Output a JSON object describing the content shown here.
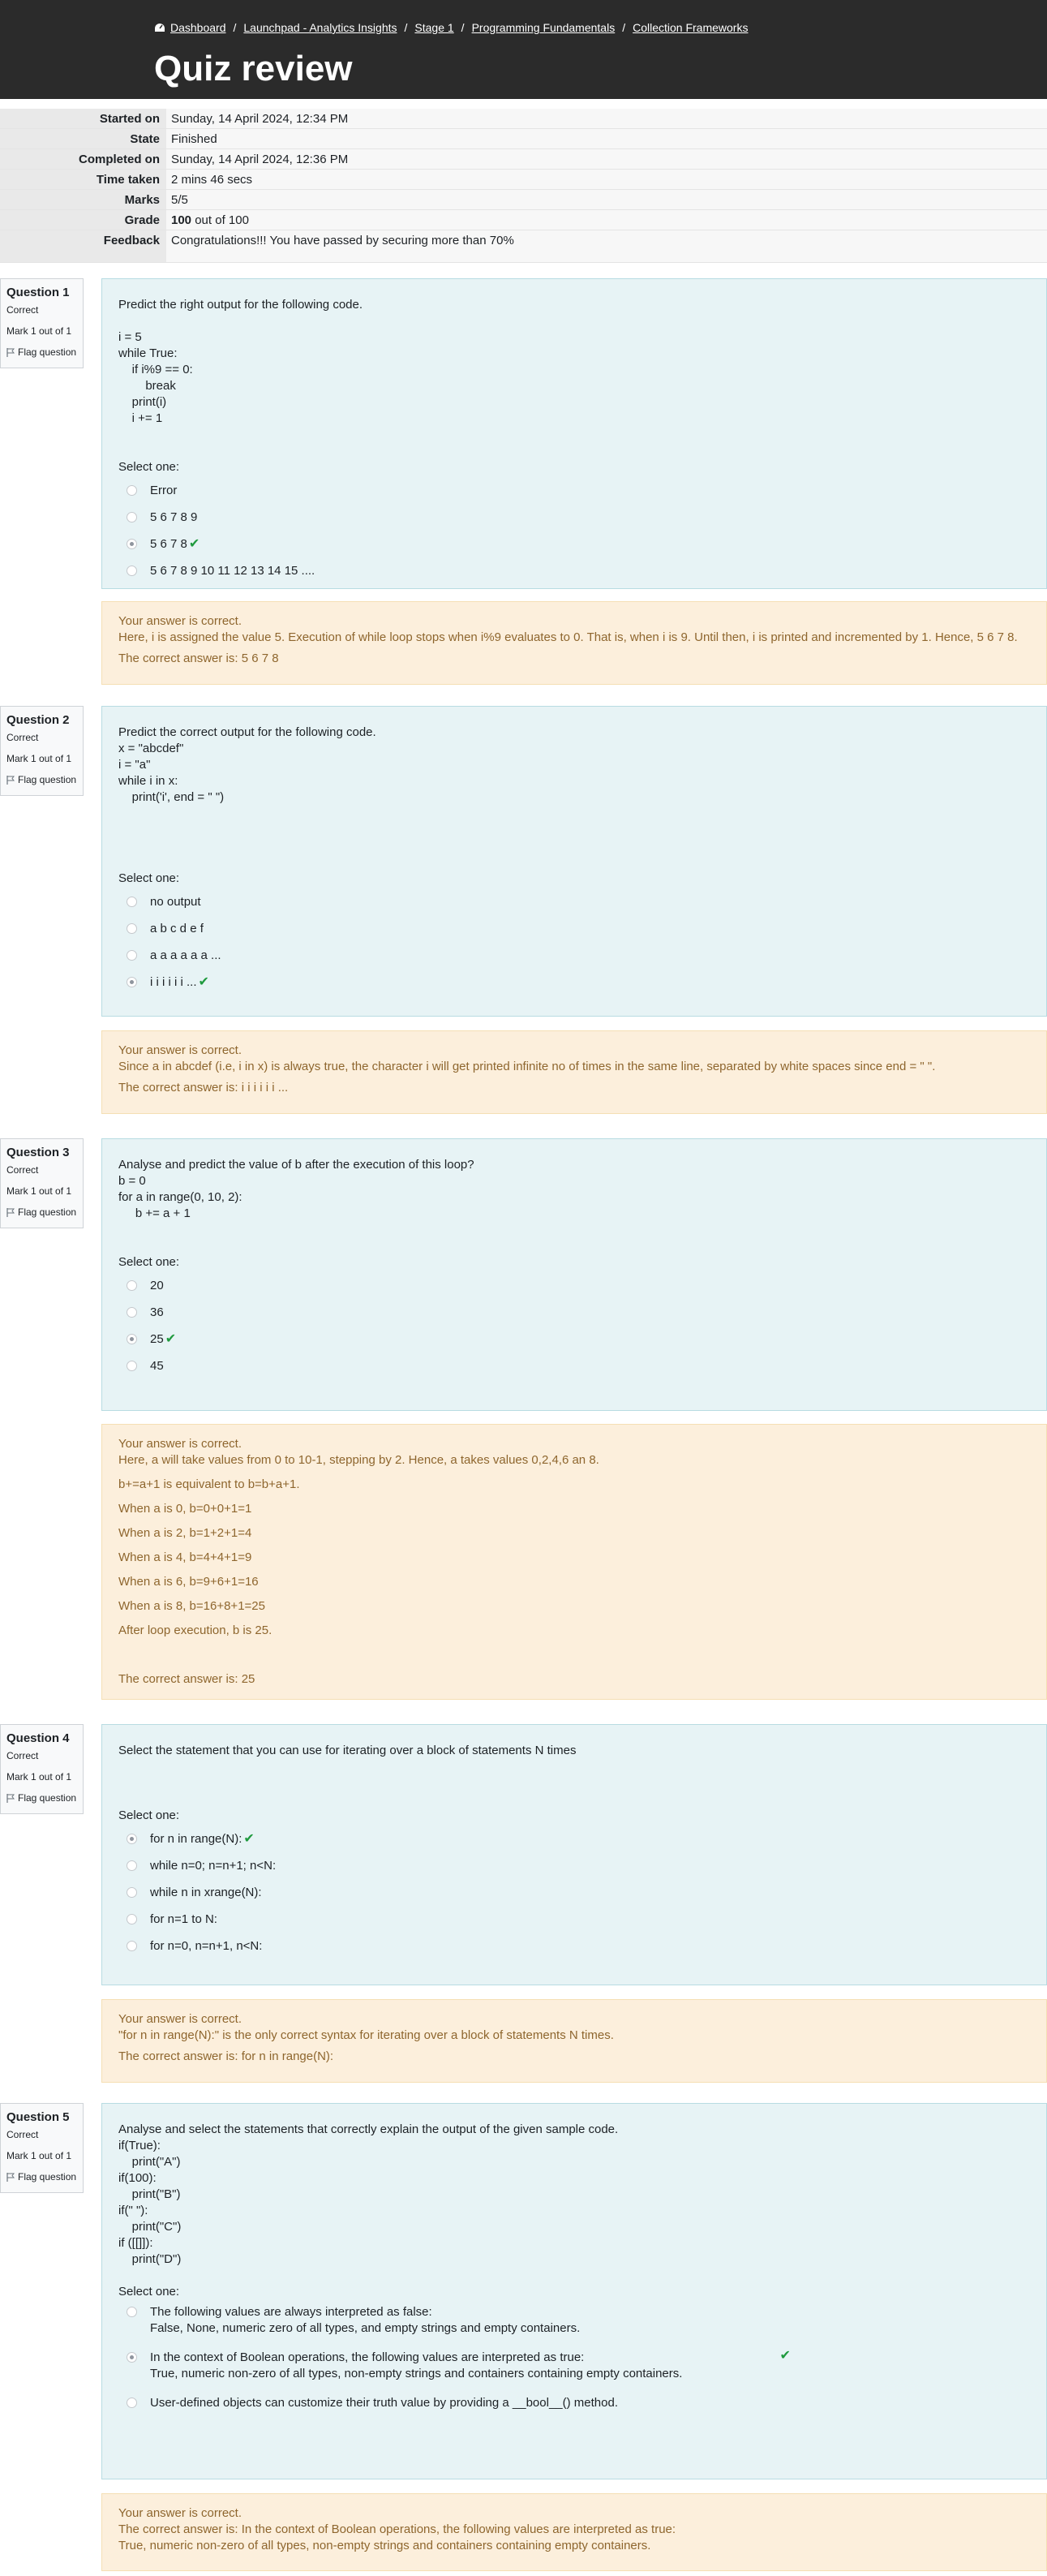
{
  "breadcrumb": [
    "Dashboard",
    "Launchpad - Analytics Insights",
    "Stage 1",
    "Programming Fundamentals",
    "Collection Frameworks"
  ],
  "page_title": "Quiz review",
  "summary": [
    {
      "k": "Started on",
      "v": "Sunday, 14 April 2024, 12:34 PM"
    },
    {
      "k": "State",
      "v": "Finished"
    },
    {
      "k": "Completed on",
      "v": "Sunday, 14 April 2024, 12:36 PM"
    },
    {
      "k": "Time taken",
      "v": "2 mins 46 secs"
    },
    {
      "k": "Marks",
      "v": "5/5"
    },
    {
      "k": "Grade",
      "v_bold": "100",
      "v": "out of 100"
    },
    {
      "k": "Feedback",
      "v": "Congratulations!!! You have passed by securing more than 70%"
    }
  ],
  "qinfo_labels": {
    "state": "Correct",
    "mark": "Mark 1 out of 1",
    "flag": "Flag question",
    "select": "Select one:"
  },
  "questions": [
    {
      "number": "Question 1",
      "text": [
        "Predict the right output for the following code.",
        "",
        "i = 5",
        "while True:",
        "    if i%9 == 0:",
        "        break",
        "    print(i)",
        "    i += 1",
        "",
        ""
      ],
      "options": [
        "Error",
        "5 6 7 8 9",
        "5 6 7 8",
        "5 6 7 8 9 10 11 12 13 14 15 ...."
      ],
      "selected": 2,
      "feedback": [
        "Your answer is correct.",
        "Here, i is assigned the value 5. Execution of while loop stops when i%9 evaluates to 0.  That is, when i is 9. Until then, i is printed and incremented by 1. Hence, 5 6 7 8.",
        "The correct answer is: 5 6 7 8"
      ]
    },
    {
      "number": "Question 2",
      "text": [
        "Predict the correct output for the following code.",
        "x = \"abcdef\"",
        "i = \"a\"",
        "while i in x:",
        "    print('i', end = \" \")",
        "",
        "",
        "",
        ""
      ],
      "options": [
        "no output",
        "a b c d e f",
        "a a a a a a ...",
        "i i i i i i ..."
      ],
      "selected": 3,
      "feedback": [
        "Your answer is correct.",
        "Since a in abcdef (i.e, i in x) is always true, the character i will get printed infinite no of times in the same line, separated by white spaces since end = \" \".",
        "The correct answer is: i i i i i i ..."
      ]
    },
    {
      "number": "Question 3",
      "text": [
        "Analyse and predict the value of b after the execution of this loop?",
        "b = 0",
        "for a in range(0, 10, 2):",
        "     b += a + 1",
        "",
        ""
      ],
      "options": [
        "20",
        "36",
        "25",
        "45"
      ],
      "selected": 2,
      "feedback": [
        "Your answer is correct.",
        "Here, a will take values from 0 to 10-1, stepping by 2.  Hence, a takes values 0,2,4,6 an 8.",
        "b+=a+1 is equivalent to b=b+a+1.",
        "When a is 0, b=0+0+1=1",
        "When a is 2, b=1+2+1=4",
        "When a is 4, b=4+4+1=9",
        "When a is 6, b=9+6+1=16",
        "When a is 8, b=16+8+1=25",
        "After loop execution, b is 25.",
        "",
        "The correct answer is: 25"
      ]
    },
    {
      "number": "Question 4",
      "text": [
        "Select the statement that you can use for iterating over a block of statements N times",
        "",
        "",
        ""
      ],
      "options": [
        "for n in range(N):",
        "while n=0; n=n+1; n<N:",
        "while n in xrange(N):",
        "for n=1 to N:",
        "for n=0, n=n+1, n<N:"
      ],
      "selected": 0,
      "feedback": [
        "Your answer is correct.",
        "\"for n in range(N):\" is the only correct syntax for iterating over a block of statements N times.",
        "The correct answer is: for n in range(N):"
      ]
    },
    {
      "number": "Question 5",
      "text": [
        "Analyse and select the statements that correctly explain the output of the given sample code.",
        "if(True):",
        "    print(\"A\")",
        "if(100):",
        "    print(\"B\")",
        "if(\" \"):",
        "    print(\"C\")",
        "if ([[]]):",
        "    print(\"D\")",
        ""
      ],
      "options": [
        [
          "The following values are always interpreted as false:",
          "False, None, numeric zero of all types, and empty strings and empty containers."
        ],
        [
          "In the context of Boolean operations, the following values are interpreted as true:",
          "True, numeric non-zero of all types, non-empty strings and containers containing empty containers."
        ],
        [
          "User-defined objects can customize their truth value by providing a __bool__() method."
        ]
      ],
      "selected": 1,
      "feedback": [
        "Your answer is correct.",
        "The correct answer is: In the context of Boolean operations, the following values are interpreted as true:",
        "True, numeric non-zero of all types, non-empty strings and containers containing empty containers."
      ]
    }
  ],
  "colors": {
    "header": "#2b2b2b",
    "question_bg": "#e7f3f5",
    "feedback_bg": "#fcefdc",
    "feedback_text": "#8e662e",
    "check": "#1f9a3e"
  }
}
